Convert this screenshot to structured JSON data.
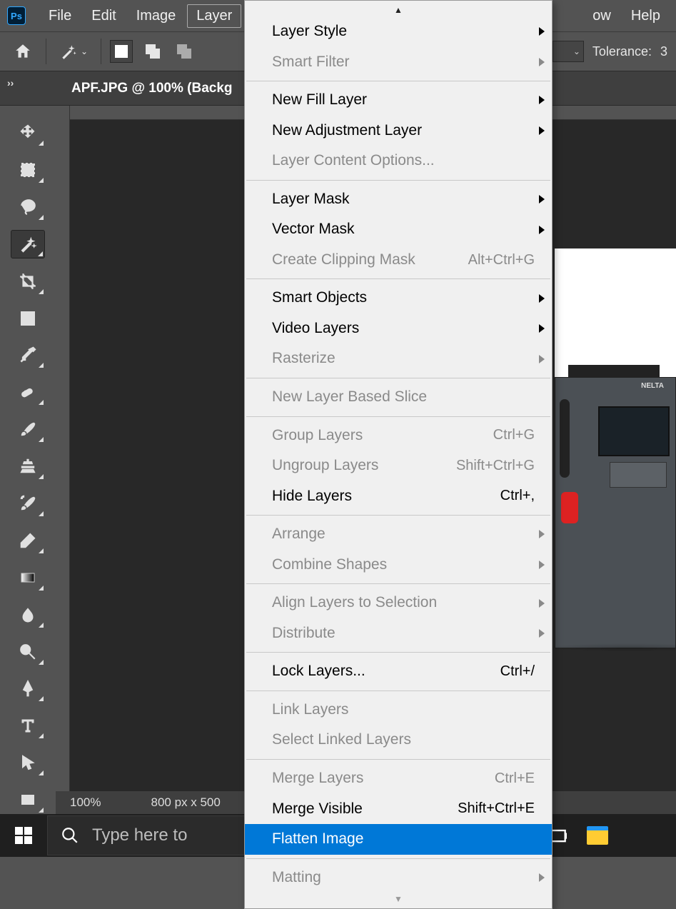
{
  "app": {
    "logo_text": "Ps"
  },
  "menubar": {
    "items": [
      "File",
      "Edit",
      "Image",
      "Layer",
      "ow",
      "Help"
    ],
    "active_index": 3
  },
  "optionsbar": {
    "tolerance_label": "Tolerance:",
    "tolerance_value": "3"
  },
  "document": {
    "tab_title": "APF.JPG @ 100% (Backg"
  },
  "status": {
    "zoom": "100%",
    "dimensions": "800 px x 500"
  },
  "canvas_device": {
    "brand": "NELTA"
  },
  "dropdown": {
    "groups": [
      [
        {
          "label": "Layer Style",
          "submenu": true,
          "disabled": false
        },
        {
          "label": "Smart Filter",
          "submenu": true,
          "disabled": true
        }
      ],
      [
        {
          "label": "New Fill Layer",
          "submenu": true,
          "disabled": false
        },
        {
          "label": "New Adjustment Layer",
          "submenu": true,
          "disabled": false
        },
        {
          "label": "Layer Content Options...",
          "submenu": false,
          "disabled": true
        }
      ],
      [
        {
          "label": "Layer Mask",
          "submenu": true,
          "disabled": false
        },
        {
          "label": "Vector Mask",
          "submenu": true,
          "disabled": false
        },
        {
          "label": "Create Clipping Mask",
          "shortcut": "Alt+Ctrl+G",
          "disabled": true
        }
      ],
      [
        {
          "label": "Smart Objects",
          "submenu": true,
          "disabled": false
        },
        {
          "label": "Video Layers",
          "submenu": true,
          "disabled": false
        },
        {
          "label": "Rasterize",
          "submenu": true,
          "disabled": true
        }
      ],
      [
        {
          "label": "New Layer Based Slice",
          "disabled": true
        }
      ],
      [
        {
          "label": "Group Layers",
          "shortcut": "Ctrl+G",
          "disabled": true
        },
        {
          "label": "Ungroup Layers",
          "shortcut": "Shift+Ctrl+G",
          "disabled": true
        },
        {
          "label": "Hide Layers",
          "shortcut": "Ctrl+,",
          "disabled": false
        }
      ],
      [
        {
          "label": "Arrange",
          "submenu": true,
          "disabled": true
        },
        {
          "label": "Combine Shapes",
          "submenu": true,
          "disabled": true
        }
      ],
      [
        {
          "label": "Align Layers to Selection",
          "submenu": true,
          "disabled": true
        },
        {
          "label": "Distribute",
          "submenu": true,
          "disabled": true
        }
      ],
      [
        {
          "label": "Lock Layers...",
          "shortcut": "Ctrl+/",
          "disabled": false
        }
      ],
      [
        {
          "label": "Link Layers",
          "disabled": true
        },
        {
          "label": "Select Linked Layers",
          "disabled": true
        }
      ],
      [
        {
          "label": "Merge Layers",
          "shortcut": "Ctrl+E",
          "disabled": true
        },
        {
          "label": "Merge Visible",
          "shortcut": "Shift+Ctrl+E",
          "disabled": false
        },
        {
          "label": "Flatten Image",
          "disabled": false,
          "highlighted": true
        }
      ],
      [
        {
          "label": "Matting",
          "submenu": true,
          "disabled": true
        }
      ]
    ]
  },
  "tools": [
    "move-tool",
    "marquee-tool",
    "lasso-tool",
    "magic-wand-tool",
    "crop-tool",
    "frame-tool",
    "eyedropper-tool",
    "healing-brush-tool",
    "brush-tool",
    "clone-stamp-tool",
    "history-brush-tool",
    "eraser-tool",
    "gradient-tool",
    "blur-tool",
    "dodge-tool",
    "pen-tool",
    "type-tool",
    "path-selection-tool",
    "rectangle-tool"
  ],
  "taskbar": {
    "search_placeholder": "Type here to"
  }
}
